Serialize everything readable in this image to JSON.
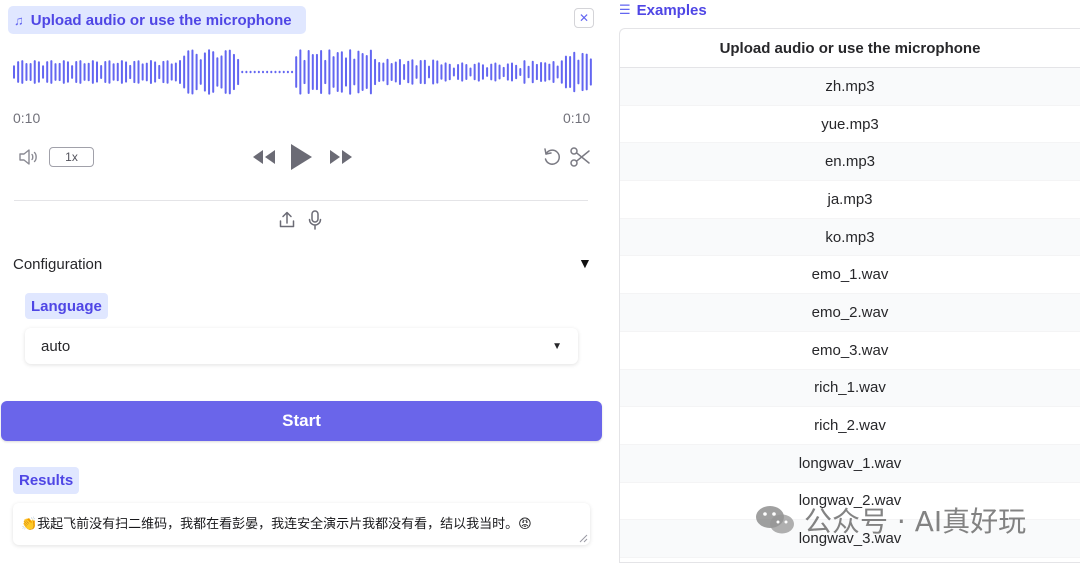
{
  "audio": {
    "label": "Upload audio or use the microphone",
    "current_time": "0:10",
    "duration": "0:10",
    "playback_rate": "1x"
  },
  "config": {
    "title": "Configuration",
    "toggle": "▼",
    "language_label": "Language",
    "language_value": "auto"
  },
  "start_label": "Start",
  "results": {
    "label": "Results",
    "text": "👏我起飞前没有扫二维码，我都在看彭晏，我连安全演示片我都没有看，结以我当时。😡"
  },
  "examples": {
    "header": "Examples",
    "column": "Upload audio or use the microphone",
    "rows": [
      "zh.mp3",
      "yue.mp3",
      "en.mp3",
      "ja.mp3",
      "ko.mp3",
      "emo_1.wav",
      "emo_2.wav",
      "emo_3.wav",
      "rich_1.wav",
      "rich_2.wav",
      "longwav_1.wav",
      "longwav_2.wav",
      "longwav_3.wav"
    ]
  },
  "watermark": "公众号 · AI真好玩",
  "colors": {
    "accent": "#4f46e5",
    "accent_light": "#e0e7ff",
    "button": "#6a65ea",
    "waveform": "#6366f1"
  }
}
